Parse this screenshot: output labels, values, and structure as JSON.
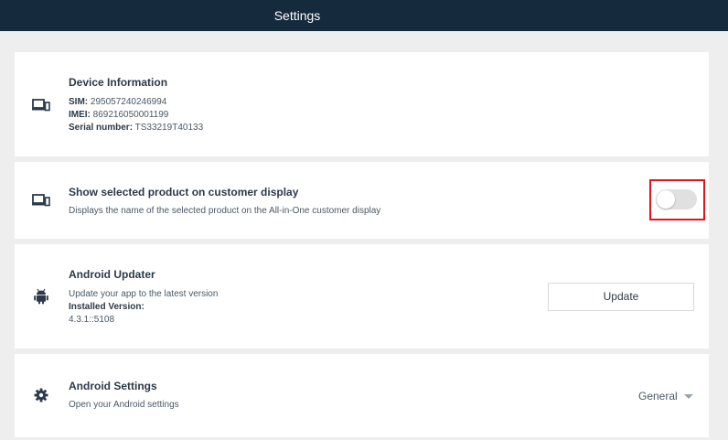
{
  "header": {
    "title": "Settings"
  },
  "device_info": {
    "icon": "devices-icon",
    "title": "Device Information",
    "sim_label": "SIM:",
    "sim_value": "295057240246994",
    "imei_label": "IMEI:",
    "imei_value": "869216050001199",
    "serial_label": "Serial number:",
    "serial_value": "TS33219T40133"
  },
  "customer_display": {
    "icon": "devices-icon",
    "title": "Show selected product on customer display",
    "description": "Displays the name of the selected product on the All-in-One customer display",
    "toggle_on": false,
    "highlight_color": "#e0141e"
  },
  "android_updater": {
    "icon": "android-icon",
    "title": "Android Updater",
    "description": "Update your app to the latest version",
    "installed_label": "Installed Version:",
    "installed_value": "4.3.1::5108",
    "button_label": "Update"
  },
  "android_settings": {
    "icon": "gear-icon",
    "title": "Android Settings",
    "description": "Open your Android settings",
    "select_value": "General"
  }
}
